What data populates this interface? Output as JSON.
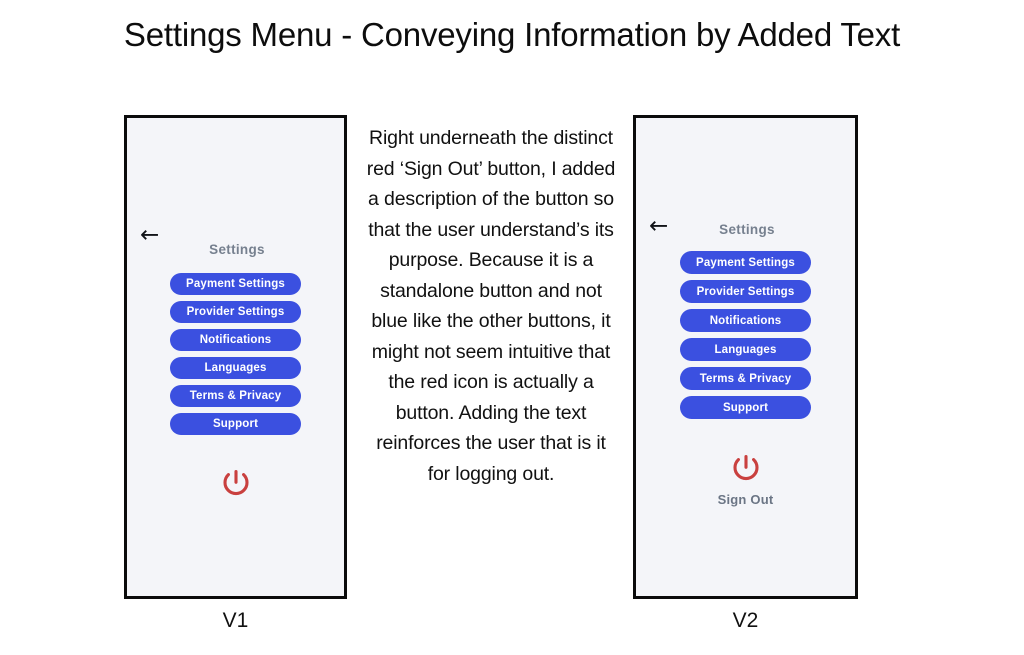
{
  "page": {
    "title": "Settings Menu - Conveying Information by Added Text",
    "background_color": "#ffffff"
  },
  "colors": {
    "button_blue": "#3b50e0",
    "power_red": "#c9403f",
    "title_gray": "#76808f",
    "signout_gray": "#6b7585",
    "panel_bg": "#f4f5f9",
    "panel_border": "#0b0b0b"
  },
  "annotation": {
    "text": "Right underneath the distinct red ‘Sign Out’ button, I added a description of the button so that the user understand’s its purpose. Because it is a standalone button and not blue like the other buttons, it might not seem intuitive that the red icon is actually a button. Adding the text reinforces the user that is it for logging out."
  },
  "v1": {
    "caption": "V1",
    "back_arrow": "←",
    "screen_title": "Settings",
    "menu_items": [
      {
        "label": "Payment Settings"
      },
      {
        "label": "Provider Settings"
      },
      {
        "label": "Notifications"
      },
      {
        "label": "Languages"
      },
      {
        "label": "Terms & Privacy"
      },
      {
        "label": "Support"
      }
    ],
    "power_icon": "power-icon",
    "signout_label": ""
  },
  "v2": {
    "caption": "V2",
    "back_arrow": "←",
    "screen_title": "Settings",
    "menu_items": [
      {
        "label": "Payment Settings"
      },
      {
        "label": "Provider Settings"
      },
      {
        "label": "Notifications"
      },
      {
        "label": "Languages"
      },
      {
        "label": "Terms & Privacy"
      },
      {
        "label": "Support"
      }
    ],
    "power_icon": "power-icon",
    "signout_label": "Sign Out"
  }
}
